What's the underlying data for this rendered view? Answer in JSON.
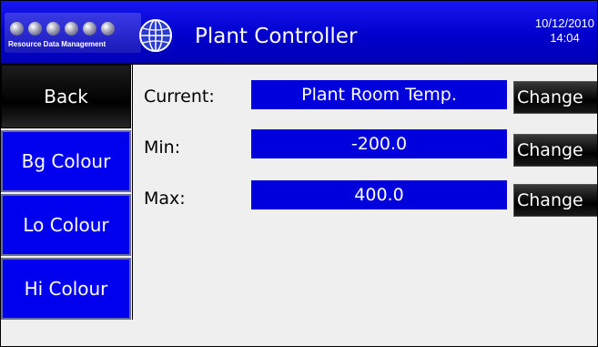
{
  "header": {
    "logo_text": "Resource Data Management",
    "title": "Plant Controller",
    "date": "10/12/2010",
    "time": "14:04",
    "icons": {
      "logo": "logo-dots-icon",
      "globe": "globe-icon"
    }
  },
  "sidebar": {
    "items": [
      {
        "label": "Back"
      },
      {
        "label": "Bg Colour"
      },
      {
        "label": "Lo Colour"
      },
      {
        "label": "Hi Colour"
      }
    ]
  },
  "main": {
    "rows": [
      {
        "label": "Current:",
        "value": "Plant Room Temp.",
        "button": "Change"
      },
      {
        "label": "Min:",
        "value": "-200.0",
        "button": "Change"
      },
      {
        "label": "Max:",
        "value": "400.0",
        "button": "Change"
      }
    ]
  },
  "colors": {
    "header_blue": "#0000cc",
    "value_blue": "#0000dd",
    "sidebar_blue": "#0000ee",
    "button_black": "#000000",
    "background": "#efefef"
  }
}
